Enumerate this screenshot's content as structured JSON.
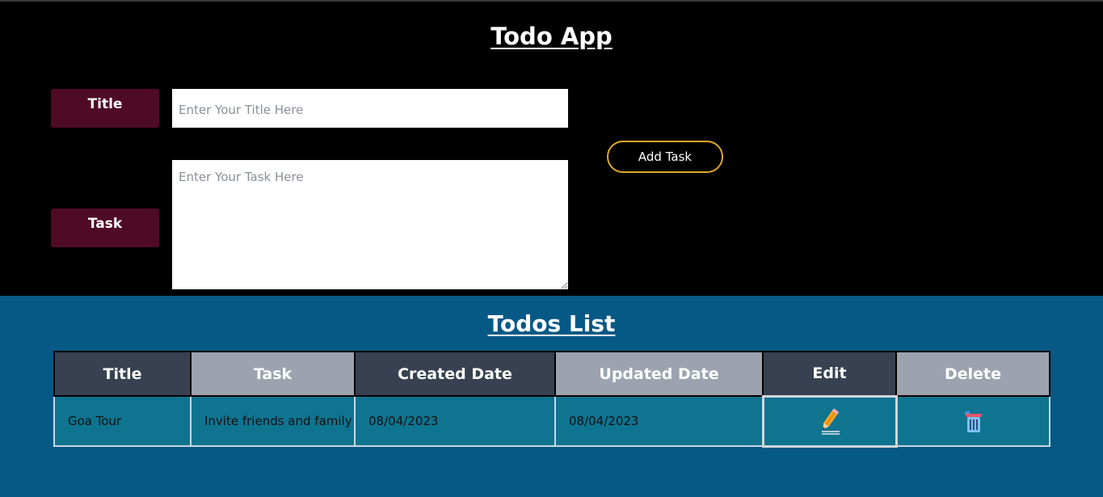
{
  "app": {
    "title": "Todo App"
  },
  "form": {
    "title_label": "Title",
    "task_label": "Task",
    "title_placeholder": "Enter Your Title Here",
    "task_placeholder": "Enter Your Task Here",
    "title_value": "",
    "task_value": "",
    "add_button": "Add Task"
  },
  "list": {
    "title": "Todos List",
    "columns": [
      "Title",
      "Task",
      "Created Date",
      "Updated Date",
      "Edit",
      "Delete"
    ],
    "rows": [
      {
        "title": "Goa Tour",
        "task": "Invite friends and family",
        "created": "08/04/2023",
        "updated": "08/04/2023",
        "edit_icon": "pencil-icon",
        "delete_icon": "trash-icon"
      }
    ]
  },
  "colors": {
    "header_bg": "#000000",
    "label_bg": "#4f0a25",
    "button_border": "#e0a92a",
    "list_bg": "#075985",
    "row_bg": "#0e7490",
    "th_dark": "#374151",
    "th_light": "#9ca3af"
  }
}
